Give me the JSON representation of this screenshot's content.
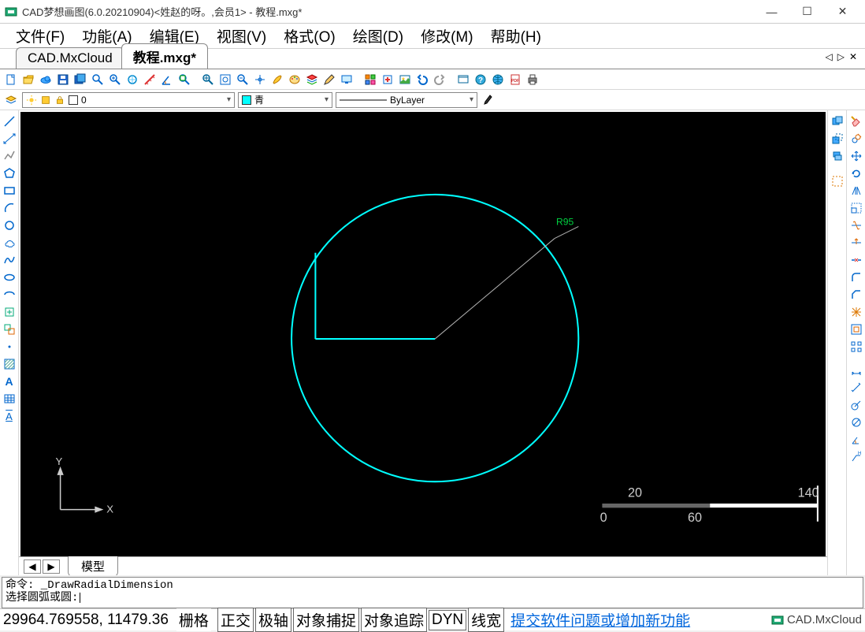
{
  "window": {
    "title": "CAD梦想画图(6.0.20210904)<姓赵的呀。,会员1> - 教程.mxg*"
  },
  "menu": {
    "file": "文件(F)",
    "func": "功能(A)",
    "edit": "编辑(E)",
    "view": "视图(V)",
    "format": "格式(O)",
    "draw": "绘图(D)",
    "modify": "修改(M)",
    "help": "帮助(H)"
  },
  "doc_tabs": {
    "tab1": "CAD.MxCloud",
    "tab2": "教程.mxg*"
  },
  "layer": {
    "current": "0"
  },
  "color": {
    "current": "青"
  },
  "linetype": {
    "current": "ByLayer"
  },
  "drawing": {
    "dim_label": "R95",
    "axis_x": "X",
    "axis_y": "Y",
    "ruler_0": "0",
    "ruler_20": "20",
    "ruler_60": "60",
    "ruler_140": "140"
  },
  "layout_tab": "模型",
  "command": {
    "line1": "命令: _DrawRadialDimension",
    "line2": "选择圆弧或圆:"
  },
  "status": {
    "coords": "29964.769558,  11479.36",
    "grid": "栅格",
    "ortho": "正交",
    "polar": "极轴",
    "osnap": "对象捕捉",
    "otrack": "对象追踪",
    "dyn": "DYN",
    "lwt": "线宽",
    "link": "提交软件问题或增加新功能",
    "brand": "CAD.MxCloud"
  }
}
